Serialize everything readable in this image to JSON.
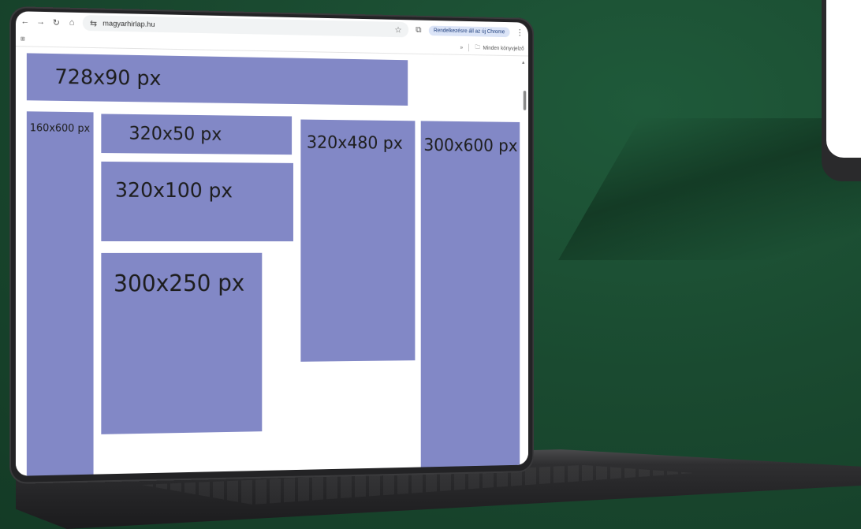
{
  "browser": {
    "url": "magyarhirlap.hu",
    "update_label": "Rendelkezésre áll az új Chrome",
    "bookmarks_label": "Minden könyvjelző"
  },
  "ads": [
    {
      "label": "728x90 px"
    },
    {
      "label": "160x600 px"
    },
    {
      "label": "320x50 px"
    },
    {
      "label": "320x100 px"
    },
    {
      "label": "300x250 px"
    },
    {
      "label": "320x480 px"
    },
    {
      "label": "300x600 px"
    }
  ],
  "colors": {
    "ad_fill": "#8288c6",
    "background": "#1a4a30"
  },
  "icons": [
    "back-icon",
    "forward-icon",
    "reload-icon",
    "home-icon",
    "site-settings-icon",
    "star-icon",
    "extensions-icon",
    "menu-icon",
    "apps-icon",
    "chevron-icon",
    "folder-icon"
  ]
}
